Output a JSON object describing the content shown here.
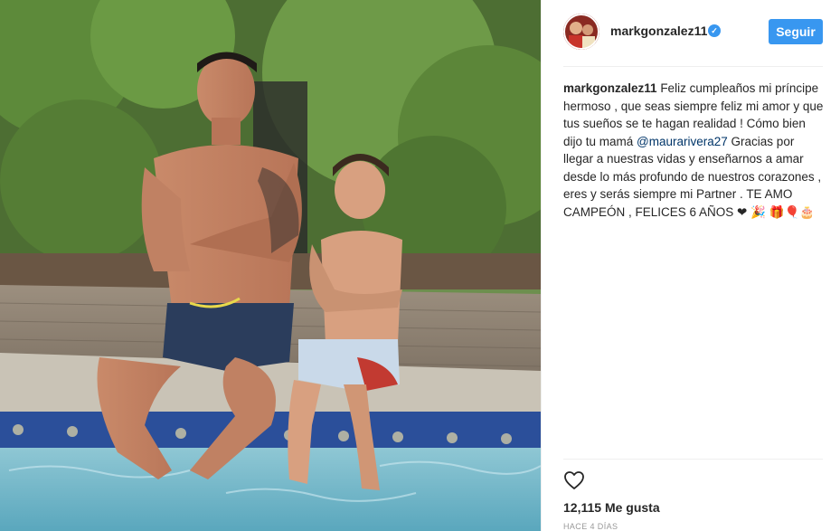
{
  "post": {
    "photo_name": "father-and-son-poolside-photo"
  },
  "header": {
    "username": "markgonzalez11",
    "verified_icon": "verified-badge-icon",
    "follow_label": "Seguir"
  },
  "caption": {
    "username": "markgonzalez11",
    "text_before_mention": " Feliz cumpleaños mi príncipe hermoso , que seas siempre feliz mi amor y que tus sueños se te hagan realidad ! Cómo bien dijo tu mamá ",
    "mention": "@maurarivera27",
    "text_after_mention": " Gracias por llegar a nuestras vidas y enseñarnos a amar desde lo más profundo de nuestros corazones , eres y serás siempre mi Partner . TE AMO CAMPEÓN , FELICES 6 AÑOS ❤ 🎉 🎁🎈🎂"
  },
  "actions": {
    "like_icon": "heart-icon"
  },
  "stats": {
    "likes_count": "12,115",
    "likes_label": "Me gusta",
    "timestamp": "HACE 4 DÍAS"
  },
  "colors": {
    "accent": "#3897f0",
    "mention": "#003569",
    "muted": "#999999",
    "text": "#262626"
  }
}
